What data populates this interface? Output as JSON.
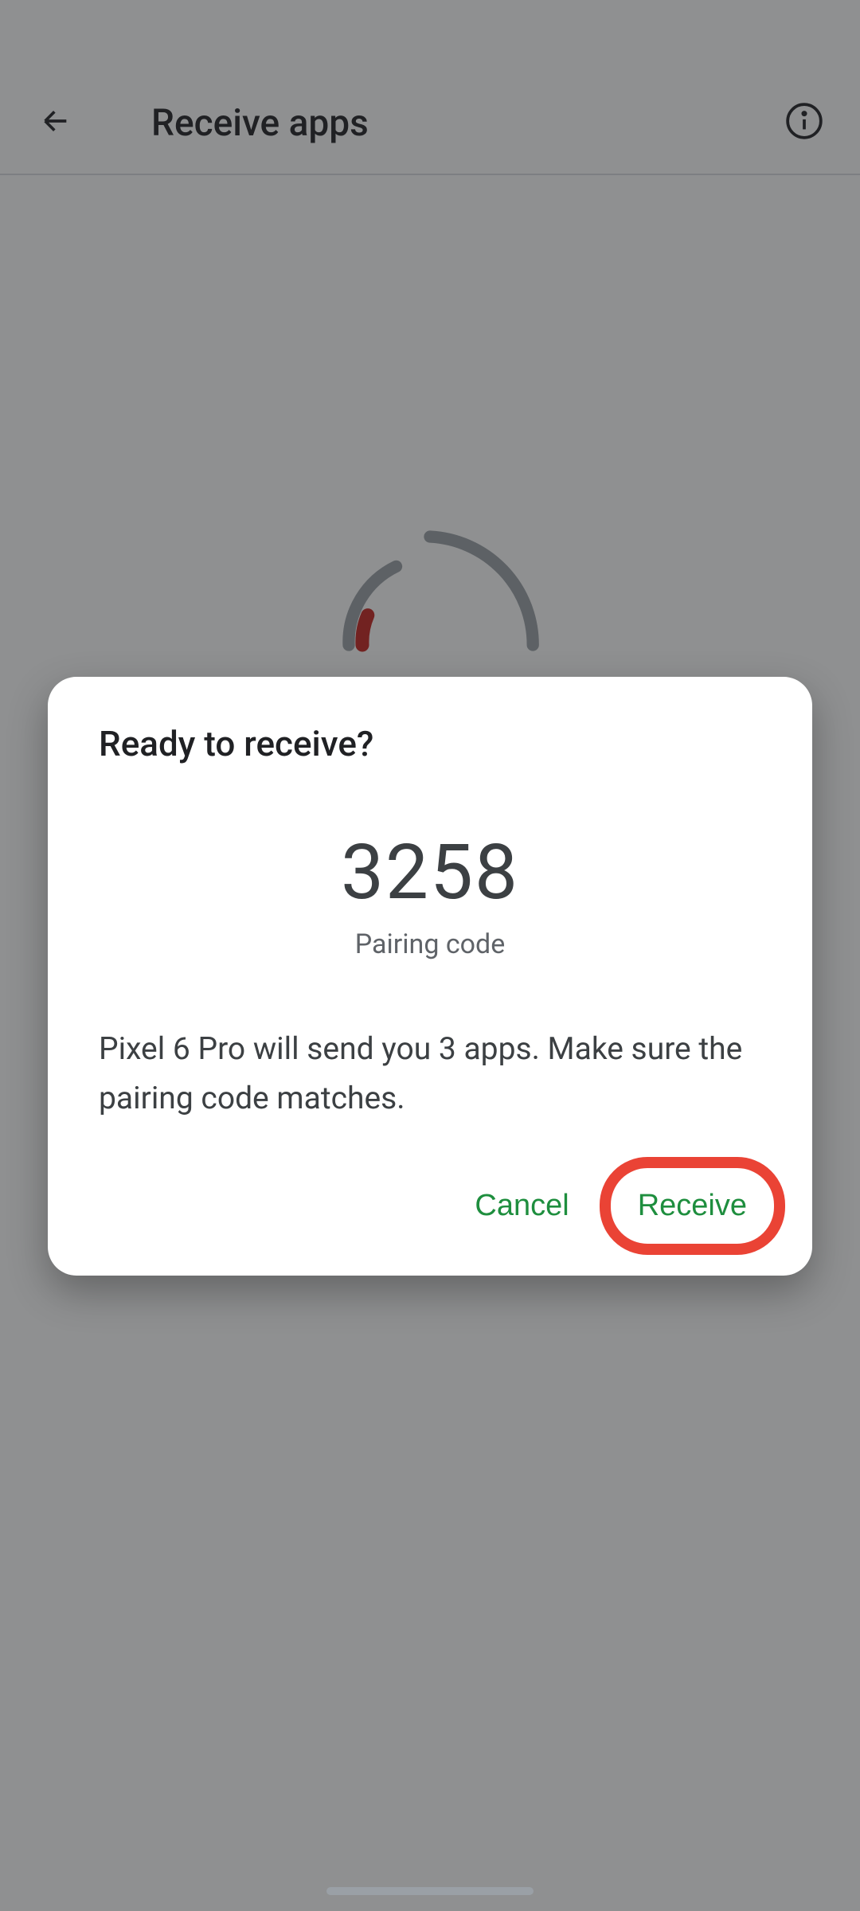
{
  "header": {
    "title": "Receive apps"
  },
  "dialog": {
    "title": "Ready to receive?",
    "pairing_code": "3258",
    "pairing_label": "Pairing code",
    "body": "Pixel 6 Pro will send you 3 apps. Make sure the pairing code matches.",
    "cancel_label": "Cancel",
    "receive_label": "Receive"
  },
  "colors": {
    "accent_green": "#1e8e3e",
    "highlight_red": "#ea4335",
    "spinner_red": "#c5221f"
  }
}
